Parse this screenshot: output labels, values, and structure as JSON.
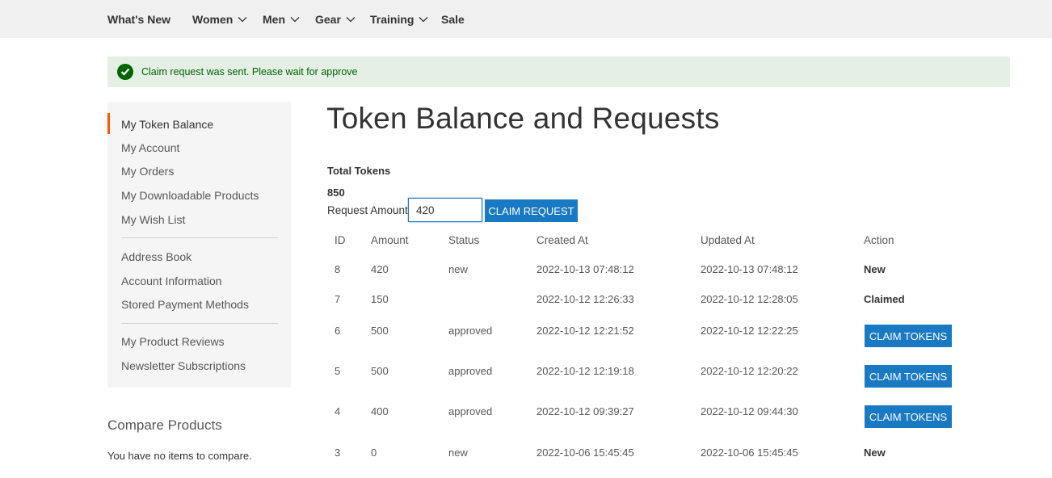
{
  "nav": {
    "items": [
      {
        "label": "What's New",
        "dropdown": false
      },
      {
        "label": "Women",
        "dropdown": true
      },
      {
        "label": "Men",
        "dropdown": true
      },
      {
        "label": "Gear",
        "dropdown": true
      },
      {
        "label": "Training",
        "dropdown": true
      },
      {
        "label": "Sale",
        "dropdown": false
      }
    ]
  },
  "message": {
    "text": "Claim request was sent. Please wait for approve",
    "icon": "check-circle-icon",
    "color": "#006400",
    "background": "#e5efe5"
  },
  "sidebar": {
    "items": [
      {
        "label": "My Token Balance",
        "current": true
      },
      {
        "label": "My Account"
      },
      {
        "label": "My Orders"
      },
      {
        "label": "My Downloadable Products"
      },
      {
        "label": "My Wish List"
      },
      {
        "label": "Address Book"
      },
      {
        "label": "Account Information"
      },
      {
        "label": "Stored Payment Methods"
      },
      {
        "label": "My Product Reviews"
      },
      {
        "label": "Newsletter Subscriptions"
      }
    ],
    "active_color": "#ff5501"
  },
  "compare": {
    "title": "Compare Products",
    "empty": "You have no items to compare."
  },
  "main": {
    "title": "Token Balance and Requests",
    "total_label": "Total Tokens",
    "total_value": "850",
    "request_label": "Request Amount",
    "request_value": "420",
    "claim_request_label": "CLAIM REQUEST",
    "accent": "#1979c3"
  },
  "table": {
    "headers": [
      "ID",
      "Amount",
      "Status",
      "Created At",
      "Updated At",
      "Action"
    ],
    "rows": [
      {
        "id": "8",
        "amount": "420",
        "status": "new",
        "created": "2022-10-13 07:48:12",
        "updated": "2022-10-13 07:48:12",
        "action": "New",
        "action_type": "text"
      },
      {
        "id": "7",
        "amount": "150",
        "status": "",
        "created": "2022-10-12 12:26:33",
        "updated": "2022-10-12 12:28:05",
        "action": "Claimed",
        "action_type": "text"
      },
      {
        "id": "6",
        "amount": "500",
        "status": "approved",
        "created": "2022-10-12 12:21:52",
        "updated": "2022-10-12 12:22:25",
        "action": "CLAIM TOKENS",
        "action_type": "button"
      },
      {
        "id": "5",
        "amount": "500",
        "status": "approved",
        "created": "2022-10-12 12:19:18",
        "updated": "2022-10-12 12:20:22",
        "action": "CLAIM TOKENS",
        "action_type": "button"
      },
      {
        "id": "4",
        "amount": "400",
        "status": "approved",
        "created": "2022-10-12 09:39:27",
        "updated": "2022-10-12 09:44:30",
        "action": "CLAIM TOKENS",
        "action_type": "button"
      },
      {
        "id": "3",
        "amount": "0",
        "status": "new",
        "created": "2022-10-06 15:45:45",
        "updated": "2022-10-06 15:45:45",
        "action": "New",
        "action_type": "text"
      }
    ]
  }
}
